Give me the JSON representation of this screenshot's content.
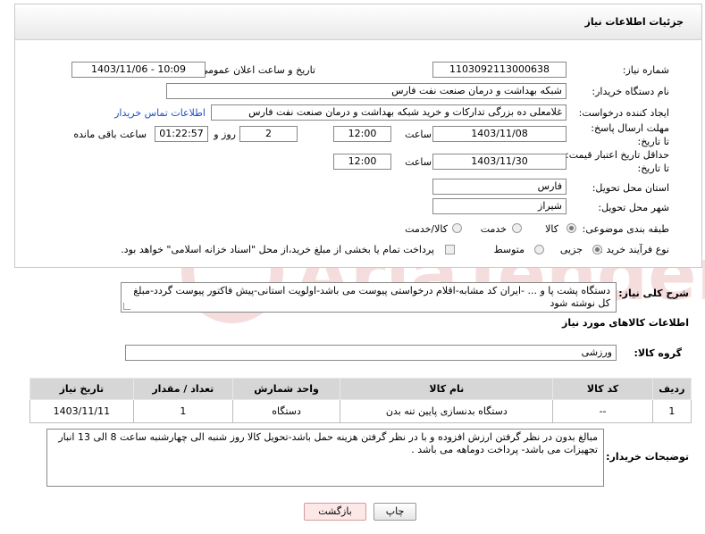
{
  "header": {
    "title": "جزئیات اطلاعات نیاز"
  },
  "fields": {
    "need_number": {
      "label": "شماره نیاز:",
      "value": "1103092113000638"
    },
    "announce_datetime": {
      "label": "تاریخ و ساعت اعلان عمومی:",
      "value": "1403/11/06 - 10:09"
    },
    "buyer_org": {
      "label": "نام دستگاه خریدار:",
      "value": "شبکه بهداشت و درمان صنعت نفت فارس"
    },
    "requester": {
      "label": "ایجاد کننده درخواست:",
      "value": "غلامعلی ده بزرگی تدارکات و خرید شبکه بهداشت و درمان صنعت نفت فارس",
      "contact_link": "اطلاعات تماس خریدار"
    },
    "reply_deadline": {
      "label": "مهلت ارسال پاسخ: تا تاریخ:",
      "date": "1403/11/08",
      "time_label": "ساعت",
      "time": "12:00",
      "days": "2",
      "days_label": "روز و",
      "remaining": "01:22:57",
      "remaining_label": "ساعت باقی مانده"
    },
    "price_validity": {
      "label": "حداقل تاریخ اعتبار قیمت: تا تاریخ:",
      "date": "1403/11/30",
      "time_label": "ساعت",
      "time": "12:00"
    },
    "delivery_province": {
      "label": "استان محل تحویل:",
      "value": "فارس"
    },
    "delivery_city": {
      "label": "شهر محل تحویل:",
      "value": "شیراز"
    },
    "category": {
      "label": "طبقه بندی موضوعی:",
      "options": [
        "کالا",
        "خدمت",
        "کالا/خدمت"
      ],
      "selected": "کالا"
    },
    "purchase_type": {
      "label": "نوع فرآیند خرید :",
      "options": [
        "جزیی",
        "متوسط"
      ],
      "selected": "جزیی",
      "payment_note": "پرداخت تمام یا بخشی از مبلغ خرید،از محل \"اسناد خزانه اسلامی\" خواهد بود."
    }
  },
  "description": {
    "label": "شرح کلی نیاز:",
    "text": "دستگاه پشت پا و ... -ایران کد مشابه-اقلام درخواستی پیوست می باشد-اولویت استانی-پیش فاکتور پیوست گردد-مبلغ کل نوشته شود"
  },
  "goods_info": {
    "title": "اطلاعات کالاهای مورد نیاز",
    "group_label": "گروه کالا:",
    "group_value": "ورزشی"
  },
  "items_table": {
    "columns": [
      "ردیف",
      "کد کالا",
      "نام کالا",
      "واحد شمارش",
      "تعداد / مقدار",
      "تاریخ نیاز"
    ],
    "rows": [
      [
        "1",
        "--",
        "دستگاه بدنسازی پایین تنه بدن",
        "دستگاه",
        "1",
        "1403/11/11"
      ]
    ]
  },
  "buyer_notes": {
    "label": "توضیحات خریدار:",
    "text": "مبالغ بدون در نظر گرفتن ارزش افزوده و با در نظر گرفتن هزینه حمل باشد-تحویل کالا روز شنبه الی چهارشنبه ساعت 8 الی 13 انبار تجهیزات می باشد- پرداخت دوماهه می باشد ."
  },
  "buttons": {
    "print": "چاپ",
    "back": "بازگشت"
  },
  "watermark_text": "AriaTender.net"
}
